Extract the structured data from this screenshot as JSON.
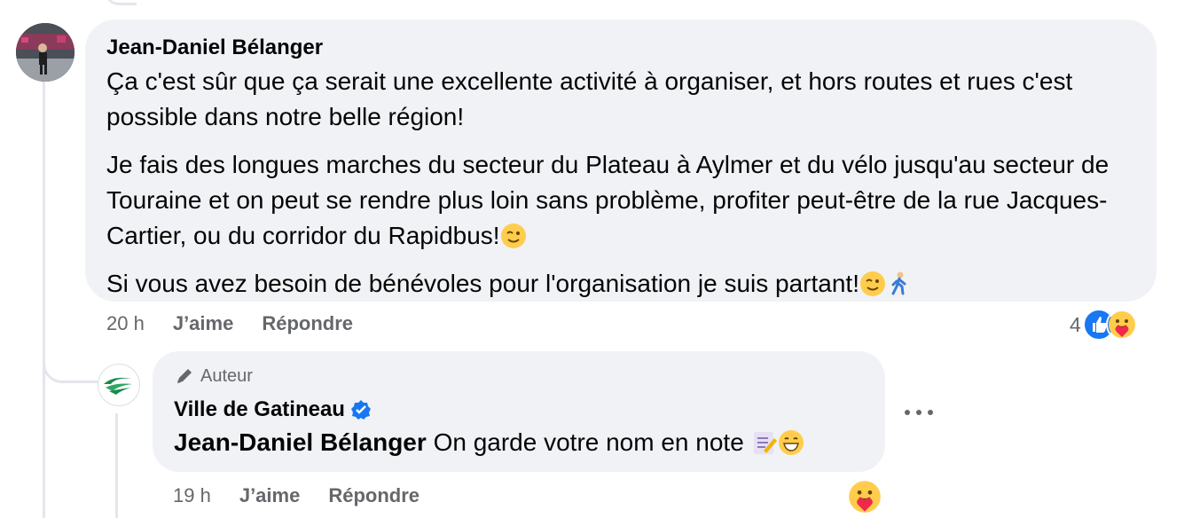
{
  "comment": {
    "author": "Jean-Daniel Bélanger",
    "paragraph1": "Ça c'est sûr que ça serait une excellente activité à organiser, et hors routes et rues c'est possible dans notre belle région!",
    "paragraph2": "Je fais des longues marches du secteur du Plateau à Aylmer et du vélo jusqu'au secteur de Touraine et on peut se rendre plus loin sans problème, profiter peut-être de la rue Jacques-Cartier, ou du corridor du Rapidbus!",
    "paragraph3": "Si vous avez besoin de bénévoles pour l'organisation je suis partant!",
    "time": "20 h",
    "like_label": "J’aime",
    "reply_label": "Répondre",
    "reaction_count": "4",
    "reactions": [
      "like-icon",
      "care-icon"
    ]
  },
  "reply": {
    "badge": "Auteur",
    "author": "Ville de Gatineau",
    "verified": true,
    "mention": "Jean-Daniel Bélanger",
    "text": "On garde votre nom en note",
    "time": "19 h",
    "like_label": "J’aime",
    "reply_label": "Répondre",
    "reactions": [
      "care-icon"
    ]
  },
  "colors": {
    "bubble": "#f0f2f5",
    "meta_text": "#65676b",
    "like_blue": "#1877f2",
    "verified_blue": "#1877f2",
    "thread_line": "#e4e6eb"
  }
}
